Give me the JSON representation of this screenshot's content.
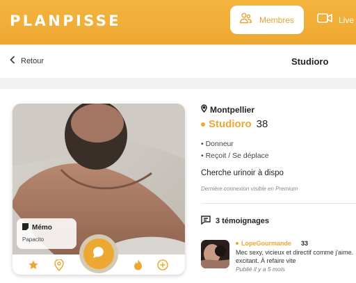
{
  "header": {
    "logo": "PLANPISSE",
    "nav": [
      {
        "label": "Membres",
        "icon": "members-icon",
        "active": true
      },
      {
        "label": "Live",
        "icon": "video-icon",
        "active": false
      }
    ]
  },
  "subheader": {
    "back_label": "Retour",
    "title": "Studioro"
  },
  "profile": {
    "city": "Montpellier",
    "name": "Studioro",
    "age": "38",
    "traits": [
      "• Donneur",
      "• Reçoit / Se déplace"
    ],
    "description": "Cherche urinoir à dispo",
    "last_connection": "Dernière connexion visible en Premium",
    "memo": {
      "title": "Mémo",
      "text": "Papacito"
    }
  },
  "testimonials": {
    "heading": "3 témoignages",
    "items": [
      {
        "name": "LopeGourmande",
        "age": "33",
        "text_line1": "Mec sexy, vicieux et directif comme j'aime.",
        "text_line2": "excitant. À refaire vite",
        "date": "Publié il y a 5 mois"
      }
    ]
  },
  "colors": {
    "brand": "#eda831",
    "header_bg": "#f4b43e"
  }
}
